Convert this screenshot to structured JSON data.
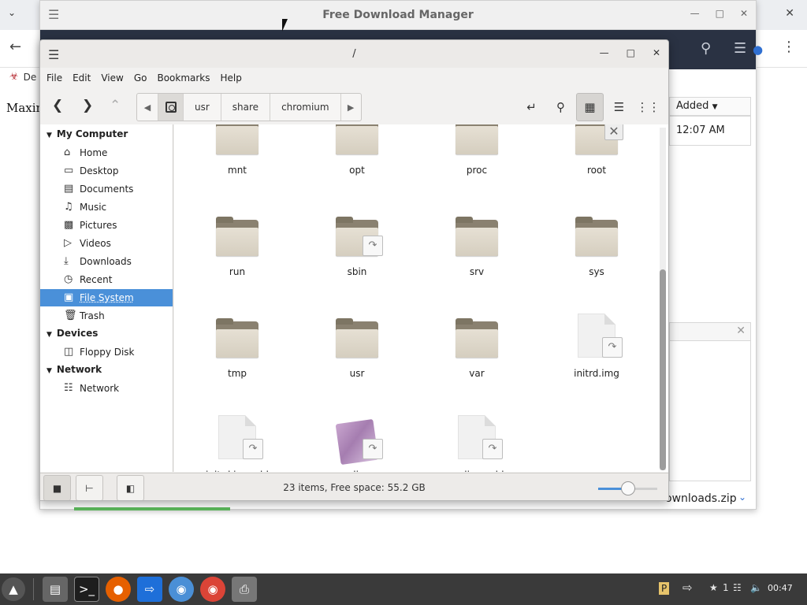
{
  "background_browser": {
    "bookmark_label": "De",
    "page_text": "Maxim"
  },
  "fdm": {
    "title": "Free Download Manager",
    "column_added": "Added",
    "row_added": "12:07 AM",
    "file_name": "ownloads.zip",
    "progress": 1.0
  },
  "file_manager": {
    "title": "/",
    "menu": [
      "File",
      "Edit",
      "View",
      "Go",
      "Bookmarks",
      "Help"
    ],
    "breadcrumb": [
      "usr",
      "share",
      "chromium"
    ],
    "sidebar": {
      "my_computer": "My Computer",
      "devices": "Devices",
      "network_header": "Network",
      "items": [
        {
          "label": "Home",
          "icon": "home-icon"
        },
        {
          "label": "Desktop",
          "icon": "desktop-icon"
        },
        {
          "label": "Documents",
          "icon": "documents-icon"
        },
        {
          "label": "Music",
          "icon": "music-icon"
        },
        {
          "label": "Pictures",
          "icon": "pictures-icon"
        },
        {
          "label": "Videos",
          "icon": "videos-icon"
        },
        {
          "label": "Downloads",
          "icon": "downloads-icon"
        },
        {
          "label": "Recent",
          "icon": "recent-icon"
        },
        {
          "label": "File System",
          "icon": "filesystem-icon",
          "selected": true
        },
        {
          "label": "Trash",
          "icon": "trash-icon"
        }
      ],
      "device_items": [
        {
          "label": "Floppy Disk",
          "icon": "floppy-icon"
        }
      ],
      "network_items": [
        {
          "label": "Network",
          "icon": "network-icon"
        }
      ]
    },
    "files": [
      {
        "name": "mnt",
        "type": "folder",
        "badge": "none"
      },
      {
        "name": "opt",
        "type": "folder",
        "badge": "none"
      },
      {
        "name": "proc",
        "type": "folder",
        "badge": "none"
      },
      {
        "name": "root",
        "type": "folder",
        "badge": "locked"
      },
      {
        "name": "run",
        "type": "folder",
        "badge": "none"
      },
      {
        "name": "sbin",
        "type": "folder",
        "badge": "link"
      },
      {
        "name": "srv",
        "type": "folder",
        "badge": "none"
      },
      {
        "name": "sys",
        "type": "folder",
        "badge": "none"
      },
      {
        "name": "tmp",
        "type": "folder",
        "badge": "none"
      },
      {
        "name": "usr",
        "type": "folder",
        "badge": "none"
      },
      {
        "name": "var",
        "type": "folder",
        "badge": "none"
      },
      {
        "name": "initrd.img",
        "type": "file",
        "badge": "link"
      },
      {
        "name": "initrd.img.old",
        "type": "file",
        "badge": "link"
      },
      {
        "name": "vmlinuz",
        "type": "image",
        "badge": "link"
      },
      {
        "name": "vmlinuz.old",
        "type": "file",
        "badge": "link"
      }
    ],
    "status": "23 items, Free space: 55.2 GB",
    "zoom_level": 0.5
  },
  "taskbar": {
    "tray_count": "1",
    "clock": "00:47"
  },
  "colors": {
    "selection": "#4a90d9",
    "fdm_header": "#2a3243",
    "taskbar": "#3a3a3a"
  }
}
